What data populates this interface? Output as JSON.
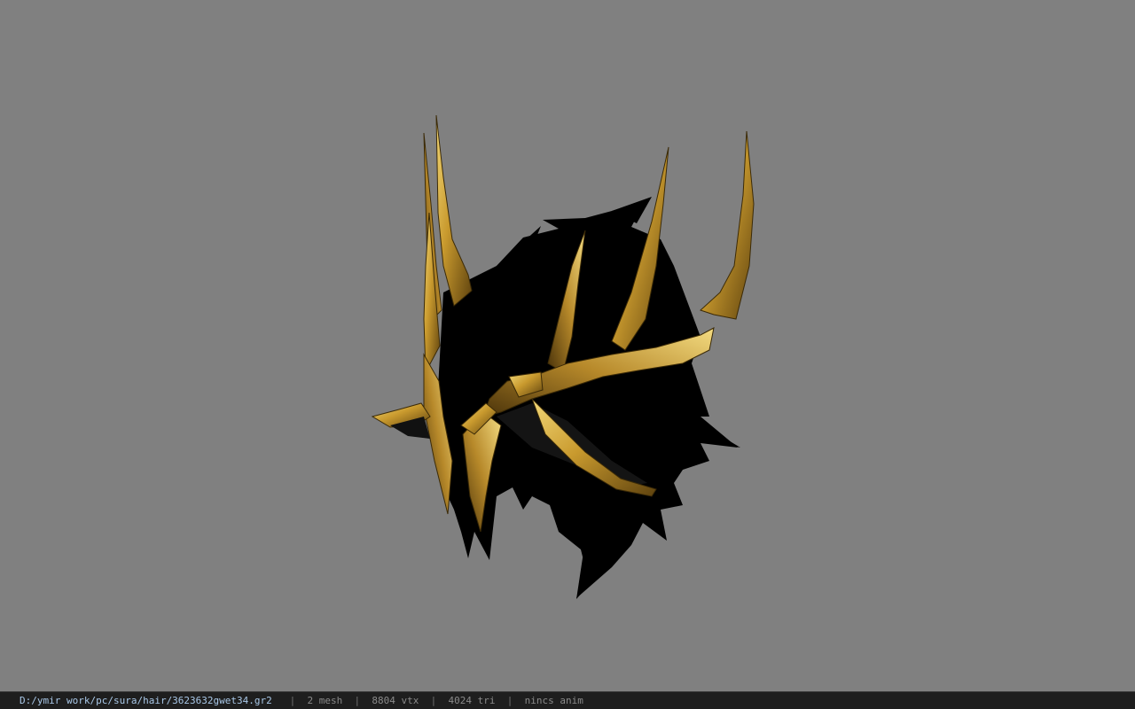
{
  "viewer": {
    "background_color": "#808080",
    "model_colors": {
      "hair": "#000000",
      "gold_light": "#e8c25a",
      "gold_dark": "#6b4e12"
    }
  },
  "status_bar": {
    "file_path": "D:/ymir work/pc/sura/hair/3623632gwet34.gr2",
    "separator": "|",
    "mesh_count": "2 mesh",
    "vertex_count": "8804 vtx",
    "triangle_count": "4024 tri",
    "anim_status": "nincs anim"
  }
}
